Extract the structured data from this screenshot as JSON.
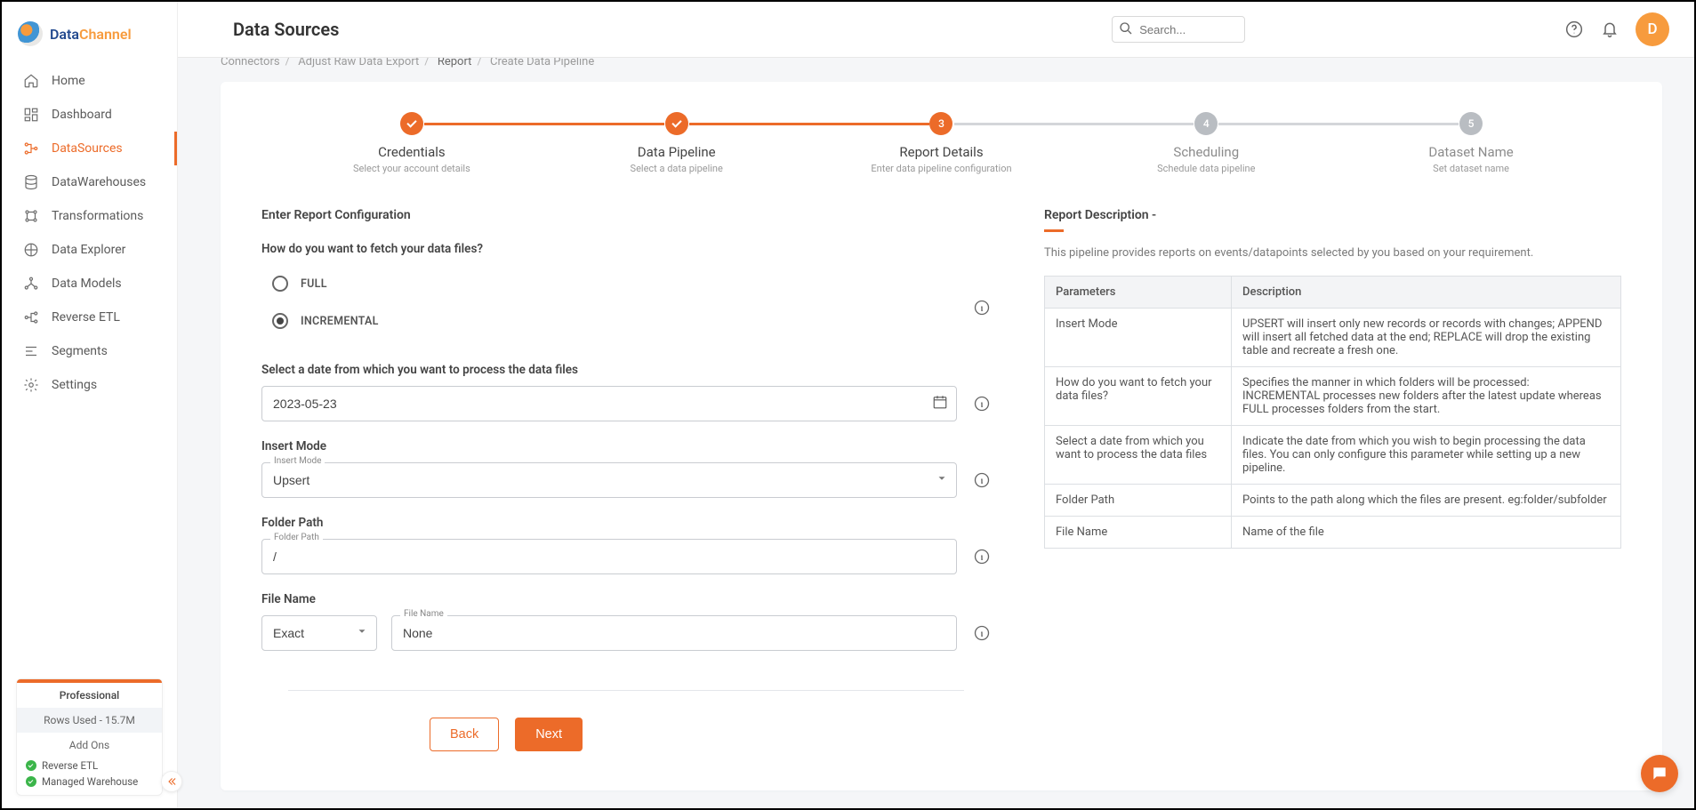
{
  "app_name": {
    "part1": "Data",
    "part2": "Channel"
  },
  "header": {
    "title": "Data Sources",
    "search_placeholder": "Search...",
    "avatar_letter": "D"
  },
  "sidebar": {
    "items": [
      {
        "label": "Home"
      },
      {
        "label": "Dashboard"
      },
      {
        "label": "DataSources"
      },
      {
        "label": "DataWarehouses"
      },
      {
        "label": "Transformations"
      },
      {
        "label": "Data Explorer"
      },
      {
        "label": "Data Models"
      },
      {
        "label": "Reverse ETL"
      },
      {
        "label": "Segments"
      },
      {
        "label": "Settings"
      }
    ],
    "plan": {
      "tier": "Professional",
      "rows": "Rows Used - 15.7M",
      "addons_title": "Add Ons",
      "addon1": "Reverse ETL",
      "addon2": "Managed Warehouse"
    }
  },
  "breadcrumbs": {
    "a": "Connectors",
    "b": "Adjust Raw Data Export",
    "c": "Report",
    "d": "Create Data Pipeline"
  },
  "stepper": {
    "s1": {
      "title": "Credentials",
      "sub": "Select your account details"
    },
    "s2": {
      "title": "Data Pipeline",
      "sub": "Select a data pipeline"
    },
    "s3": {
      "num": "3",
      "title": "Report Details",
      "sub": "Enter data pipeline configuration"
    },
    "s4": {
      "num": "4",
      "title": "Scheduling",
      "sub": "Schedule data pipeline"
    },
    "s5": {
      "num": "5",
      "title": "Dataset Name",
      "sub": "Set dataset name"
    }
  },
  "form": {
    "section_title": "Enter Report Configuration",
    "fetch_q": "How do you want to fetch your data files?",
    "radio_full": "FULL",
    "radio_inc": "INCREMENTAL",
    "date_label": "Select a date from which you want to process the data files",
    "date_value": "2023-05-23",
    "insert_label": "Insert Mode",
    "insert_floating": "Insert Mode",
    "insert_value": "Upsert",
    "folder_label": "Folder Path",
    "folder_floating": "Folder Path",
    "folder_value": "/",
    "file_label": "File Name",
    "file_match_value": "Exact",
    "file_name_floating": "File Name",
    "file_name_value": "None",
    "back": "Back",
    "next": "Next"
  },
  "desc": {
    "title": "Report Description -",
    "text": "This pipeline provides reports on events/datapoints selected by you based on your requirement.",
    "th1": "Parameters",
    "th2": "Description",
    "rows": [
      {
        "p": "Insert Mode",
        "d": "UPSERT will insert only new records or records with changes; APPEND will insert all fetched data at the end; REPLACE will drop the existing table and recreate a fresh one."
      },
      {
        "p": "How do you want to fetch your data files?",
        "d": "Specifies the manner in which folders will be processed: INCREMENTAL processes new folders after the latest update whereas FULL processes folders from the start."
      },
      {
        "p": "Select a date from which you want to process the data files",
        "d": "Indicate the date from which you wish to begin processing the data files. You can only configure this parameter while setting up a new pipeline."
      },
      {
        "p": "Folder Path",
        "d": "Points to the path along which the files are present. eg:folder/subfolder"
      },
      {
        "p": "File Name",
        "d": "Name of the file"
      }
    ]
  }
}
